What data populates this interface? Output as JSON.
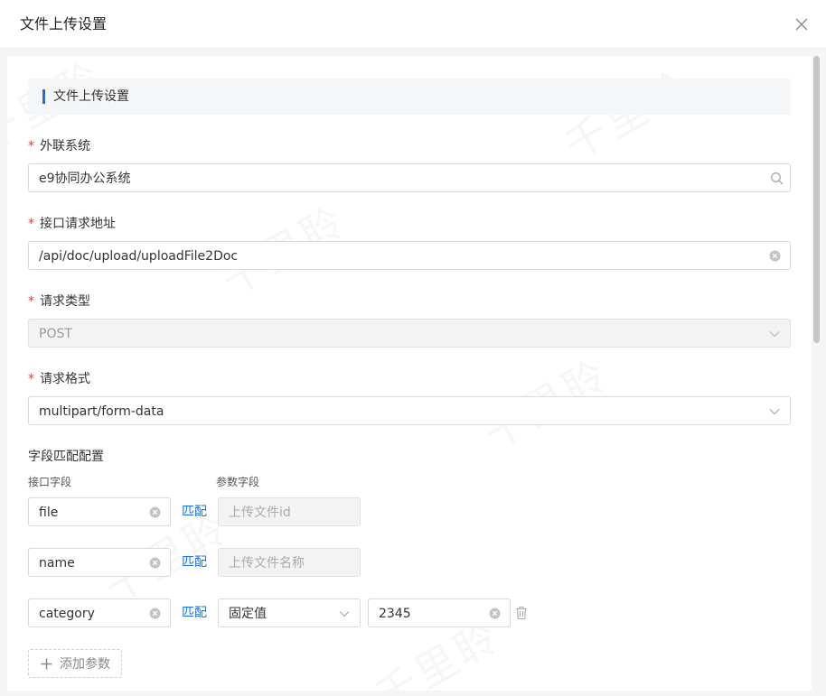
{
  "dialog": {
    "title": "文件上传设置"
  },
  "section": {
    "title": "文件上传设置"
  },
  "fields": {
    "external_system": {
      "label": "外联系统",
      "value": "e9协同办公系统"
    },
    "api_address": {
      "label": "接口请求地址",
      "value": "/api/doc/upload/uploadFile2Doc"
    },
    "request_type": {
      "label": "请求类型",
      "value": "POST"
    },
    "request_format": {
      "label": "请求格式",
      "value": "multipart/form-data"
    }
  },
  "mapping": {
    "title": "字段匹配配置",
    "col_interface": "接口字段",
    "col_param": "参数字段",
    "match_label": "匹配",
    "rows": [
      {
        "field": "file",
        "param_placeholder": "上传文件id"
      },
      {
        "field": "name",
        "param_placeholder": "上传文件名称"
      },
      {
        "field": "category",
        "param_type": "固定值",
        "param_value": "2345"
      }
    ],
    "add_label": "添加参数"
  },
  "watermark": "千里聆",
  "icons": {
    "close": "close-icon",
    "search": "search-icon",
    "clear": "clear-circle-icon",
    "dropdown": "chevron-down-icon",
    "delete": "trash-icon",
    "add": "plus-icon"
  },
  "colors": {
    "accent": "#1c6fe6",
    "required": "#e53935"
  }
}
